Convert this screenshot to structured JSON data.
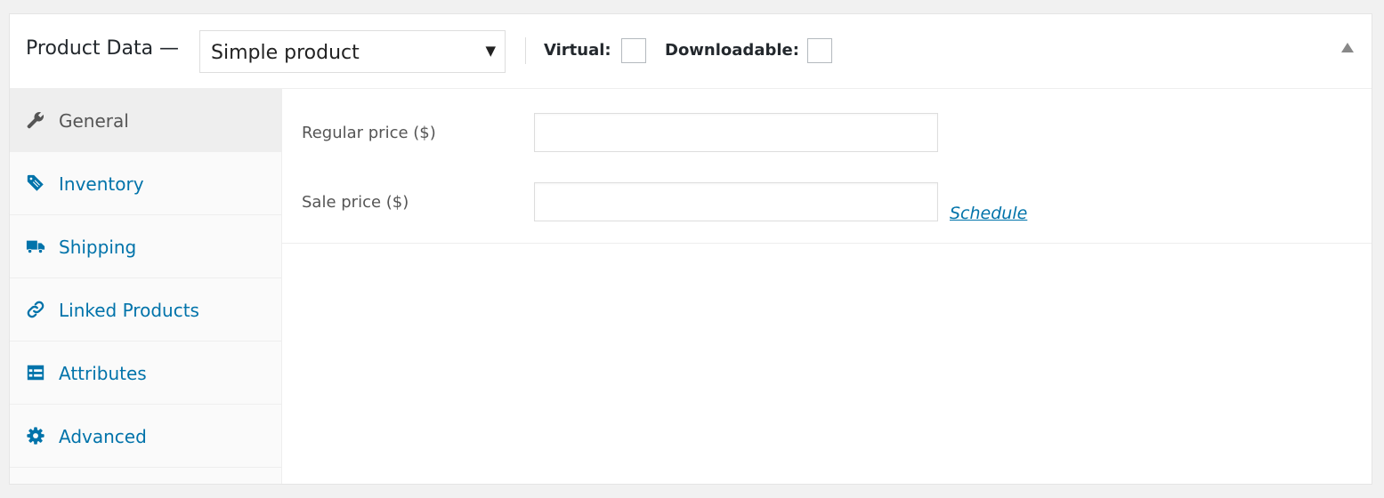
{
  "header": {
    "title": "Product Data —",
    "product_type": {
      "selected": "Simple product"
    },
    "virtual_label": "Virtual:",
    "virtual_checked": false,
    "downloadable_label": "Downloadable:",
    "downloadable_checked": false
  },
  "tabs": [
    {
      "label": "General",
      "icon": "wrench-icon",
      "active": true
    },
    {
      "label": "Inventory",
      "icon": "tag-icon",
      "active": false
    },
    {
      "label": "Shipping",
      "icon": "truck-icon",
      "active": false
    },
    {
      "label": "Linked Products",
      "icon": "link-icon",
      "active": false
    },
    {
      "label": "Attributes",
      "icon": "list-view-icon",
      "active": false
    },
    {
      "label": "Advanced",
      "icon": "gear-icon",
      "active": false
    }
  ],
  "fields": {
    "regular_price": {
      "label": "Regular price ($)",
      "value": ""
    },
    "sale_price": {
      "label": "Sale price ($)",
      "value": ""
    },
    "schedule_link": "Schedule"
  },
  "colors": {
    "link": "#0073aa",
    "active_tab_text": "#555555",
    "active_tab_bg": "#eeeeee",
    "icon_gray": "#555555"
  }
}
